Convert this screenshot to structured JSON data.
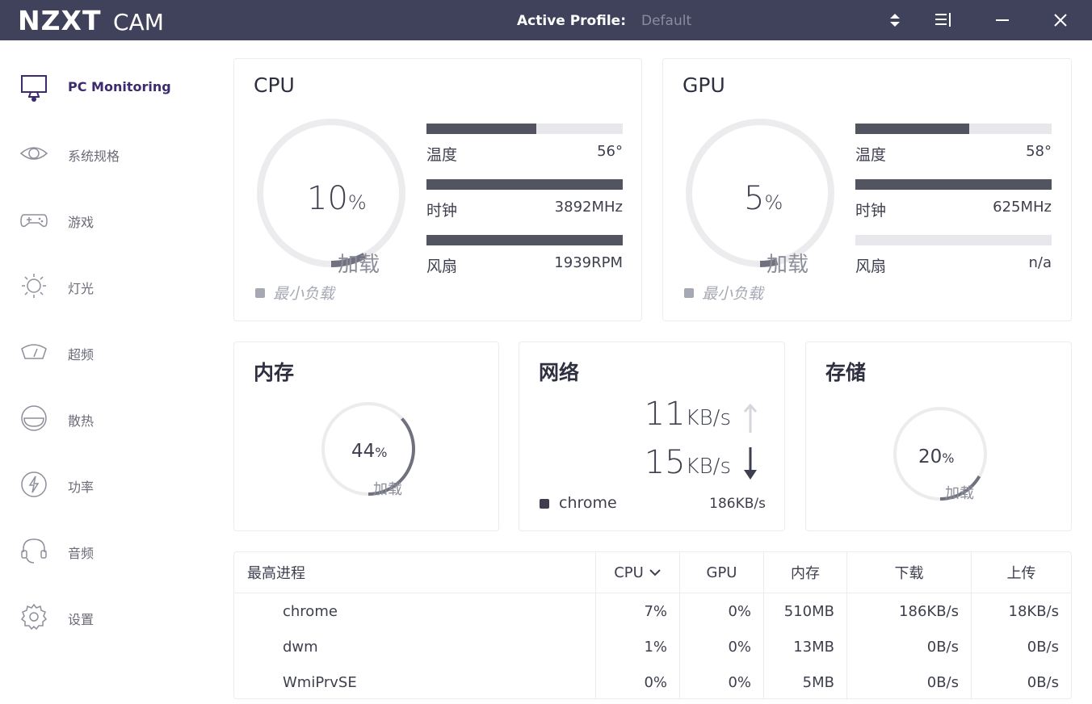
{
  "titlebar": {
    "logo_text": "NZXT",
    "logo_suffix": "CAM",
    "profile_label": "Active Profile:",
    "profile_value": "Default",
    "icons": [
      "sort-arrows-icon",
      "menu-icon",
      "minimize-icon",
      "close-icon"
    ],
    "background": "#40415a"
  },
  "sidebar": {
    "items": [
      {
        "label": "PC Monitoring",
        "icon": "monitor-icon",
        "active": true
      },
      {
        "label": "系统规格",
        "icon": "eye-icon"
      },
      {
        "label": "游戏",
        "icon": "gamepad-icon"
      },
      {
        "label": "灯光",
        "icon": "sun-icon"
      },
      {
        "label": "超频",
        "icon": "gauge-icon"
      },
      {
        "label": "散热",
        "icon": "fan-icon"
      },
      {
        "label": "功率",
        "icon": "bolt-icon"
      },
      {
        "label": "音频",
        "icon": "headset-icon"
      },
      {
        "label": "设置",
        "icon": "gear-icon"
      }
    ]
  },
  "cpu": {
    "title": "CPU",
    "load_percent": "10",
    "load_level": 0.1,
    "pct_unit": "%",
    "load_label": "加载",
    "legend": "最小负载",
    "temp_label": "温度",
    "temp_value": "56°",
    "temp_level": 0.56,
    "clock_label": "时钟",
    "clock_value": "3892MHz",
    "clock_level": 1.0,
    "fan_label": "风扇",
    "fan_value": "1939RPM",
    "fan_level": 1.0
  },
  "gpu": {
    "title": "GPU",
    "load_percent": "5",
    "load_level": 0.05,
    "pct_unit": "%",
    "load_label": "加载",
    "legend": "最小负载",
    "temp_label": "温度",
    "temp_value": "58°",
    "temp_level": 0.58,
    "clock_label": "时钟",
    "clock_value": "625MHz",
    "clock_level": 1.0,
    "fan_label": "风扇",
    "fan_value": "n/a",
    "fan_level": 0.0
  },
  "memory": {
    "title": "内存",
    "percent": "44",
    "pct_unit": "%",
    "level": 0.44,
    "load_label": "加载"
  },
  "network": {
    "title": "网络",
    "up_value": "11",
    "up_unit": "KB/s",
    "down_value": "15",
    "down_unit": "KB/s",
    "top_process": "chrome",
    "top_process_rate": "186KB/s"
  },
  "storage": {
    "title": "存储",
    "percent": "20",
    "pct_unit": "%",
    "level": 0.2,
    "load_label": "加载"
  },
  "processes": {
    "headers": [
      "最高进程",
      "CPU",
      "GPU",
      "内存",
      "下载",
      "上传"
    ],
    "rows": [
      [
        "chrome",
        "7%",
        "0%",
        "510MB",
        "186KB/s",
        "18KB/s"
      ],
      [
        "dwm",
        "1%",
        "0%",
        "13MB",
        "0B/s",
        "0B/s"
      ],
      [
        "WmiPrvSE",
        "0%",
        "0%",
        "5MB",
        "0B/s",
        "0B/s"
      ]
    ]
  },
  "colors": {
    "accent": "#3d2b6e",
    "bar": "#525460",
    "track": "#e8e8ec",
    "gauge": "#6f717e"
  }
}
